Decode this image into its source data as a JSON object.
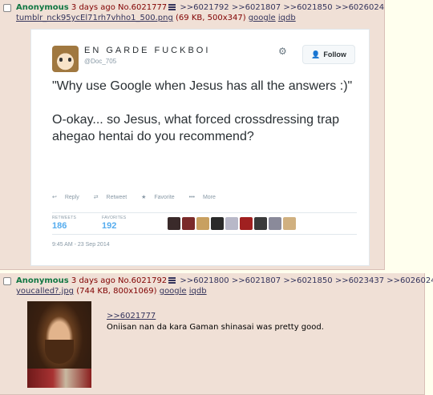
{
  "op": {
    "name": "Anonymous",
    "date": "3 days ago",
    "number": "No.6021777",
    "replies": [
      ">>6021792",
      ">>6021807",
      ">>6021850",
      ">>6026024"
    ],
    "file_name": "tumblr_nck95ycEl71rh7vhho1_500.png",
    "file_meta": "(69 KB, 500x347)",
    "google": "google",
    "iqdb": "iqdb"
  },
  "tweet": {
    "display_name": "EN GARDE FUCKBOI",
    "handle": "@Doc_705",
    "follow_label": "Follow",
    "text_1": "\"Why use Google when Jesus has all the answers :)\"",
    "text_2": "O-okay... so Jesus, what forced crossdressing trap ahegao hentai do you recommend?",
    "action_reply": "Reply",
    "action_retweet": "Retweet",
    "action_favorite": "Favorite",
    "action_more": "More",
    "retweets_label": "RETWEETS",
    "retweets_value": "186",
    "favorites_label": "FAVORITES",
    "favorites_value": "192",
    "timestamp": "9:45 AM - 23 Sep 2014"
  },
  "reply": {
    "name": "Anonymous",
    "date": "3 days ago",
    "number": "No.6021792",
    "replies": [
      ">>6021800",
      ">>6021807",
      ">>6021850",
      ">>6023437",
      ">>6026024"
    ],
    "file_name": "youcalled?.jpg",
    "file_meta": "(744 KB, 800x1069)",
    "google": "google",
    "iqdb": "iqdb",
    "quote": ">>6021777",
    "message": "Oniisan nan da kara Gaman shinasai was pretty good."
  },
  "colors": {
    "name_green": "#117743",
    "link_blue": "#34345c",
    "twitter_blue": "#55acee",
    "post_bg": "#f0e0d6"
  }
}
